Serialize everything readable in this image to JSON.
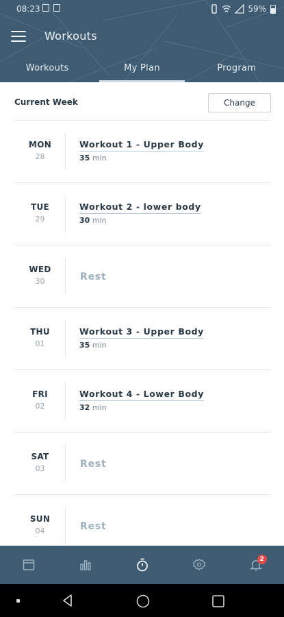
{
  "status": {
    "time": "08:23",
    "battery": "59%"
  },
  "appbar": {
    "title": "Workouts"
  },
  "tabs": [
    {
      "label": "Workouts"
    },
    {
      "label": "My Plan"
    },
    {
      "label": "Program"
    }
  ],
  "week": {
    "label": "Current Week",
    "change_label": "Change"
  },
  "days": [
    {
      "day": "MON",
      "date": "28",
      "workout": "Workout 1 - Upper Body",
      "minutes": "35",
      "unit": "min"
    },
    {
      "day": "TUE",
      "date": "29",
      "workout": "Workout 2 - lower body",
      "minutes": "30",
      "unit": "min"
    },
    {
      "day": "WED",
      "date": "30",
      "rest": "Rest"
    },
    {
      "day": "THU",
      "date": "01",
      "workout": "Workout 3 - Upper Body",
      "minutes": "35",
      "unit": "min"
    },
    {
      "day": "FRI",
      "date": "02",
      "workout": "Workout 4 - Lower Body",
      "minutes": "32",
      "unit": "min"
    },
    {
      "day": "SAT",
      "date": "03",
      "rest": "Rest"
    },
    {
      "day": "SUN",
      "date": "04",
      "rest": "Rest"
    }
  ],
  "bottom_nav": {
    "items": [
      "calendar-icon",
      "stats-icon",
      "stopwatch-icon",
      "settings-icon",
      "bell-icon"
    ],
    "notification_count": "2"
  },
  "colors": {
    "header": "#3e5b72",
    "text": "#2b3a47",
    "badge": "#e04b4b",
    "rest": "#9fb2bf"
  }
}
